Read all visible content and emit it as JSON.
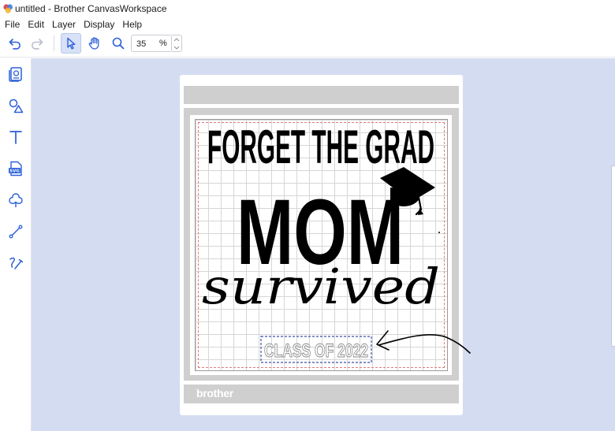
{
  "window": {
    "title": "untitled - Brother CanvasWorkspace"
  },
  "menu": {
    "items": [
      "File",
      "Edit",
      "Layer",
      "Display",
      "Help"
    ]
  },
  "toolbar": {
    "zoom_value": "35",
    "zoom_unit": "%"
  },
  "mat": {
    "brand": "brother"
  },
  "design": {
    "line1": "FORGET THE GRAD",
    "line2": "MOM",
    "line3": "survived",
    "selected_text": "CLASS OF 2022"
  },
  "icons": {
    "undo": "undo-icon",
    "redo": "redo-icon",
    "select": "pointer-icon",
    "pan": "hand-icon",
    "zoom": "magnifier-icon",
    "sidebar": [
      "templates-icon",
      "shapes-icon",
      "text-icon",
      "svg-import-icon",
      "pattern-icon",
      "line-icon",
      "freehand-icon"
    ]
  },
  "colors": {
    "canvas_bg": "#d4dcf2",
    "active_tool": "#d7e1f7",
    "icon_blue": "#2b5fd9",
    "mat_gray": "#cfcfcf"
  }
}
